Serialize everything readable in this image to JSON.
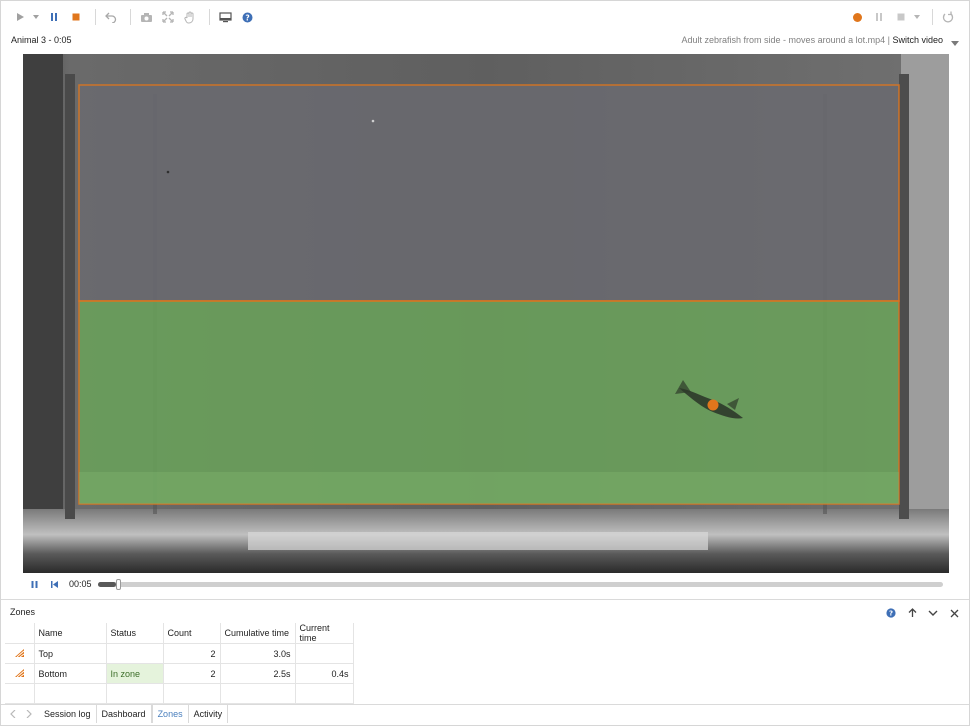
{
  "toolbar": {
    "left_icons": [
      "play-icon",
      "caret-down-icon",
      "pause-icon",
      "stop-icon",
      "undo-icon",
      "camera-icon",
      "fit-icon",
      "hand-icon",
      "screen-icon",
      "help-icon"
    ],
    "right_icons": [
      "record-icon",
      "pause-icon",
      "stop-icon",
      "caret-down-icon",
      "refresh-icon"
    ],
    "accent_color": "#e0761c",
    "blue_color": "#3e6fb6"
  },
  "header": {
    "animal_title": "Animal 3 - 0:05",
    "video_name": "Adult zebrafish from side - moves around a lot.mp4",
    "separator": " | ",
    "switch_label": "Switch video"
  },
  "video": {
    "zone_top_color": "#6a6a70",
    "zone_bottom_color": "#6aa35a",
    "outline_color": "#e0761c",
    "tracked_point_color": "#e0761c"
  },
  "playback": {
    "time": "00:05",
    "progress": 0.012
  },
  "zones": {
    "title": "Zones",
    "columns": [
      "Name",
      "Status",
      "Count",
      "Cumulative time",
      "Current time"
    ],
    "rows": [
      {
        "icon": "zone-icon",
        "name": "Top",
        "status": "",
        "count": "2",
        "cumulative": "3.0s",
        "current": ""
      },
      {
        "icon": "zone-icon",
        "name": "Bottom",
        "status": "In zone",
        "count": "2",
        "cumulative": "2.5s",
        "current": "0.4s"
      }
    ]
  },
  "tabs": {
    "items": [
      "Session log",
      "Dashboard",
      "Zones",
      "Activity"
    ],
    "active": "Zones"
  }
}
